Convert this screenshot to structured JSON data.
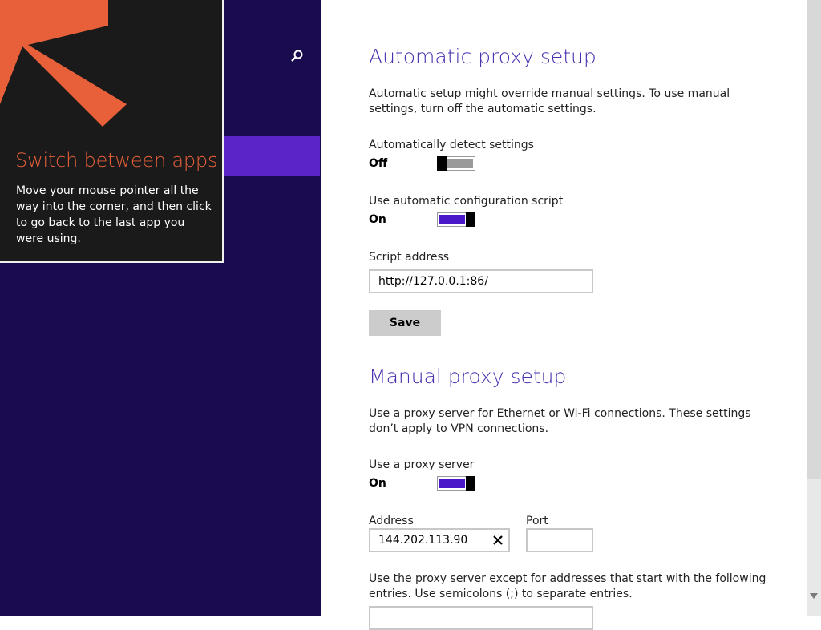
{
  "tip": {
    "title": "Switch between apps",
    "body": "Move your mouse pointer all the way into the corner, and then click to go back to the last app you were using.",
    "arrow_color": "#e8603a"
  },
  "sidebar": {
    "search_icon": "search-icon",
    "accent": "#5b24c9",
    "background": "#1a0a4e"
  },
  "automatic": {
    "title": "Automatic proxy setup",
    "description": "Automatic setup might override manual settings. To use manual settings, turn off the automatic settings.",
    "detect": {
      "label": "Automatically detect settings",
      "state": "Off"
    },
    "script": {
      "label": "Use automatic configuration script",
      "state": "On"
    },
    "script_address": {
      "label": "Script address",
      "value": "http://127.0.0.1:86/"
    },
    "save_label": "Save"
  },
  "manual": {
    "title": "Manual proxy setup",
    "description": "Use a proxy server for Ethernet or Wi-Fi connections. These settings don’t apply to VPN connections.",
    "use_proxy": {
      "label": "Use a proxy server",
      "state": "On"
    },
    "address": {
      "label": "Address",
      "value": "144.202.113.90"
    },
    "port": {
      "label": "Port",
      "value": ""
    },
    "exceptions_text": "Use the proxy server except for addresses that start with the following entries. Use semicolons (;) to separate entries."
  },
  "colors": {
    "heading": "#4a2fb0",
    "toggle_on": "#4a18c8",
    "toggle_off": "#9a9a9a"
  }
}
